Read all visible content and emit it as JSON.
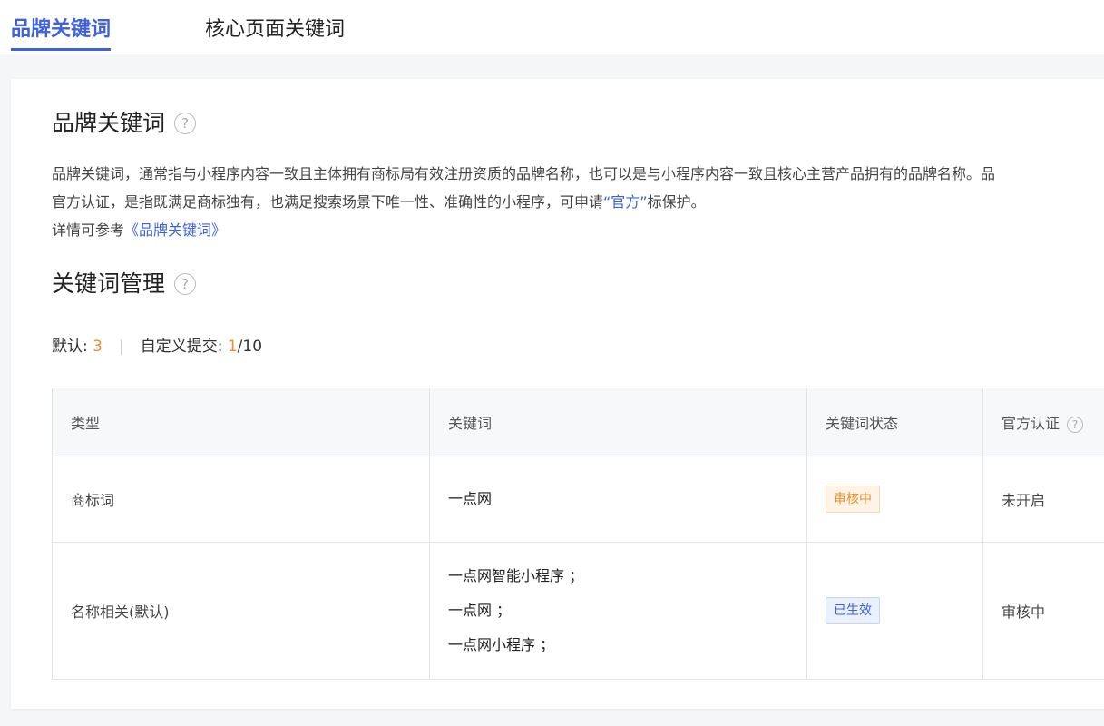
{
  "tabs": [
    {
      "label": "品牌关键词",
      "active": true
    },
    {
      "label": "核心页面关键词",
      "active": false
    }
  ],
  "brand_section": {
    "title": "品牌关键词",
    "desc_line1": "品牌关键词，通常指与小程序内容一致且主体拥有商标局有效注册资质的品牌名称，也可以是与小程序内容一致且核心主营产品拥有的品牌名称。品",
    "desc_line2_before": "官方认证，是指既满足商标独有，也满足搜索场景下唯一性、准确性的小程序，可申请",
    "desc_line2_link": "“官方”",
    "desc_line2_after": "标保护。",
    "desc_line3_before": "详情可参考",
    "desc_line3_link": "《品牌关键词》"
  },
  "manage_section": {
    "title": "关键词管理",
    "default_label": "默认: ",
    "default_count": "3",
    "custom_label": "自定义提交: ",
    "custom_used": "1",
    "custom_total": "/10"
  },
  "table": {
    "headers": [
      "类型",
      "关键词",
      "关键词状态",
      "官方认证"
    ],
    "rows": [
      {
        "type": "商标词",
        "keywords": [
          "一点网"
        ],
        "status": "审核中",
        "certification": "未开启"
      },
      {
        "type": "名称相关(默认)",
        "keywords": [
          "一点网智能小程序 ；",
          "一点网 ；",
          "一点网小程序 ；"
        ],
        "status": "已生效",
        "certification": "审核中"
      }
    ]
  },
  "colors": {
    "accent": "#3e61dd",
    "orange": "#f08c2c"
  }
}
